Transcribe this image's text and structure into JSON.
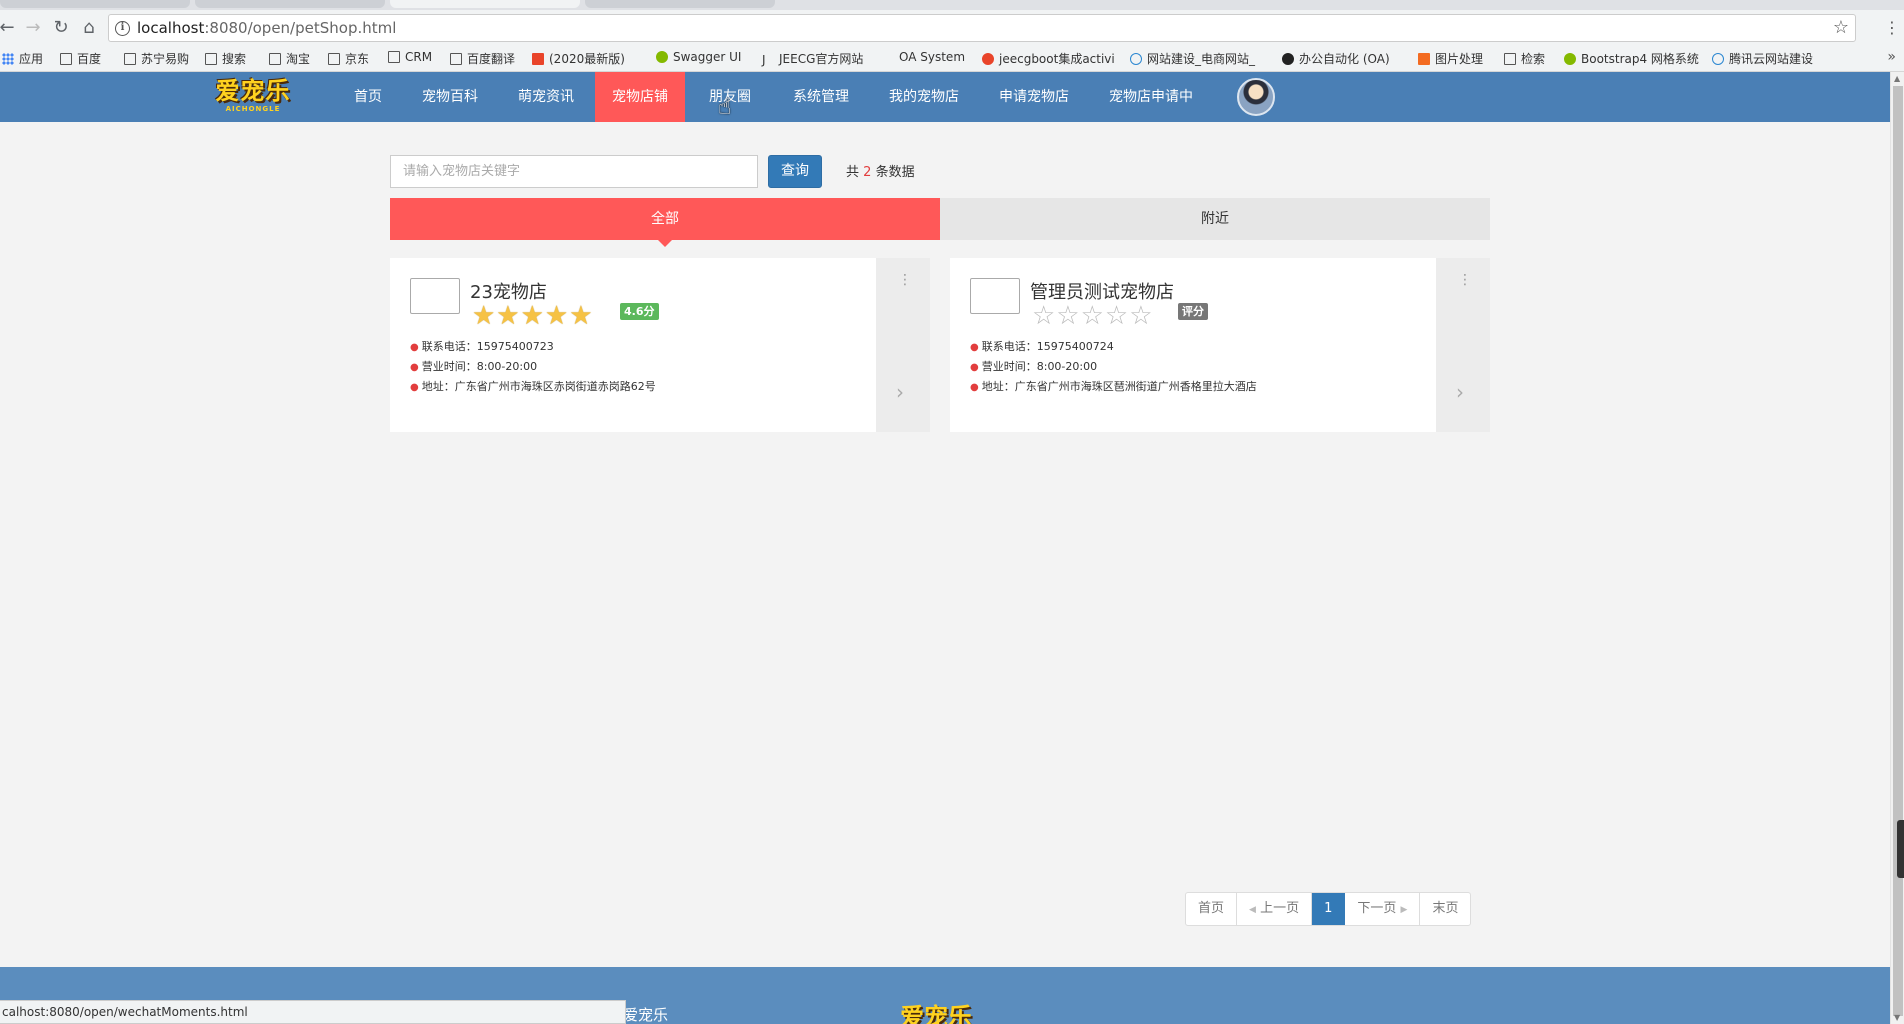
{
  "browser": {
    "url_host": "localhost",
    "url_rest": ":8080/open/petShop.html",
    "bookmarks": [
      "应用",
      "百度",
      "苏宁易购",
      "搜索",
      "淘宝",
      "京东",
      "CRM",
      "百度翻译",
      "(2020最新版)",
      "Swagger UI",
      "JEECG官方网站",
      "OA System",
      "jeecgboot集成activi",
      "网站建设_电商网站_",
      "办公自动化 (OA)",
      "图片处理",
      "检索",
      "Bootstrap4 网格系统",
      "腾讯云网站建设"
    ],
    "status_url": "calhost:8080/open/wechatMoments.html"
  },
  "site": {
    "logo_text": "爱宠乐",
    "logo_sub": "AICHONGLE",
    "nav": [
      "首页",
      "宠物百科",
      "萌宠资讯",
      "宠物店铺",
      "朋友圈",
      "系统管理",
      "我的宠物店",
      "申请宠物店",
      "宠物店申请中"
    ]
  },
  "search": {
    "placeholder": "请输入宠物店关键字",
    "button": "查询",
    "count_prefix": "共",
    "count": "2",
    "count_suffix": "条数据"
  },
  "tabs": {
    "all": "全部",
    "nearby": "附近"
  },
  "shops": [
    {
      "name": "23宠物店",
      "rating": 4.6,
      "badge": "4.6分",
      "phone": "联系电话：15975400723",
      "hours": "营业时间：8:00-20:00",
      "address": "地址：广东省广州市海珠区赤岗街道赤岗路62号"
    },
    {
      "name": "管理员测试宠物店",
      "rating": 0,
      "badge": "评分",
      "phone": "联系电话：15975400724",
      "hours": "营业时间：8:00-20:00",
      "address": "地址：广东省广州市海珠区琶洲街道广州香格里拉大酒店"
    }
  ],
  "pager": {
    "first": "首页",
    "prev": "上一页",
    "current": "1",
    "next": "下一页",
    "last": "末页"
  },
  "footer": {
    "brand": "爱宠乐",
    "logo": "爱宠乐"
  },
  "colors": {
    "navbar": "#4a7fb5",
    "active": "#ff5858",
    "primary": "#337ab7",
    "badge_green": "#5cb85c"
  }
}
